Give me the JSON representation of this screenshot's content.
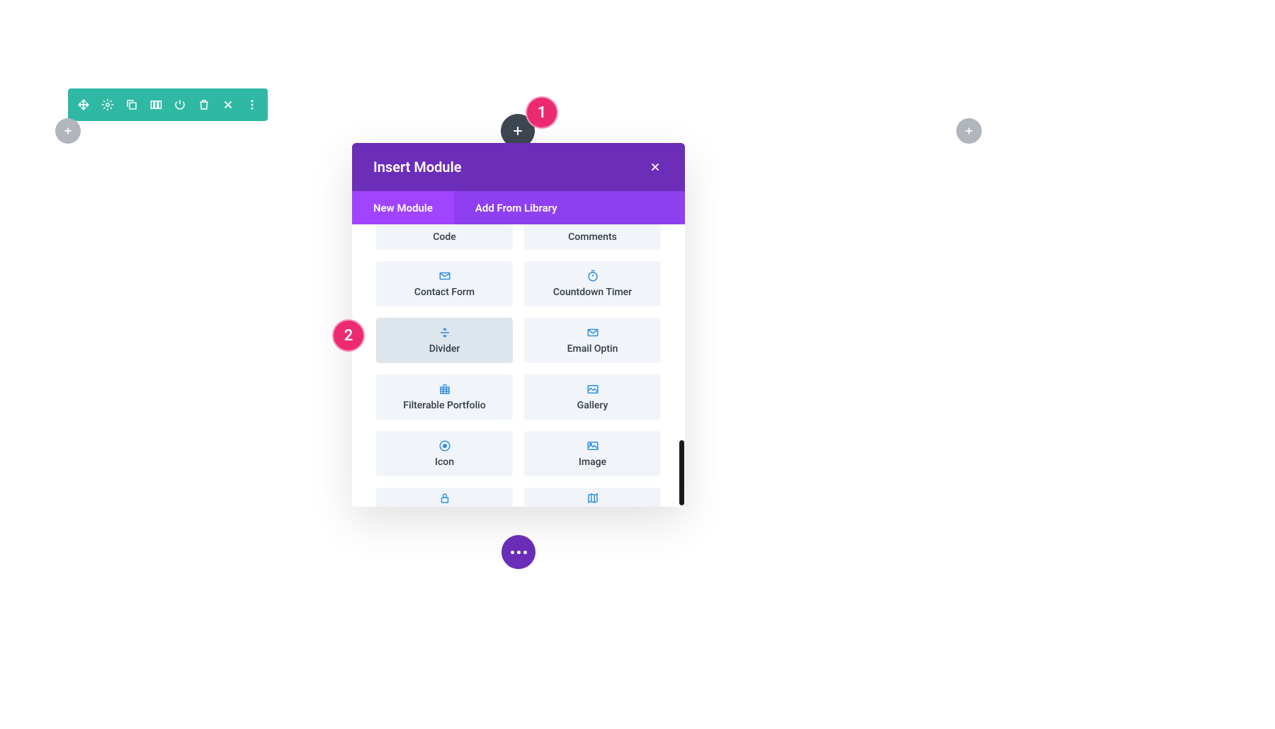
{
  "badges": {
    "one": "1",
    "two": "2"
  },
  "modal": {
    "title": "Insert Module",
    "tabs": {
      "new": "New Module",
      "library": "Add From Library"
    },
    "modules": {
      "code": "Code",
      "comments": "Comments",
      "contact_form": "Contact Form",
      "countdown": "Countdown Timer",
      "divider": "Divider",
      "email_optin": "Email Optin",
      "filterable": "Filterable Portfolio",
      "gallery": "Gallery",
      "icon": "Icon",
      "image": "Image"
    }
  }
}
